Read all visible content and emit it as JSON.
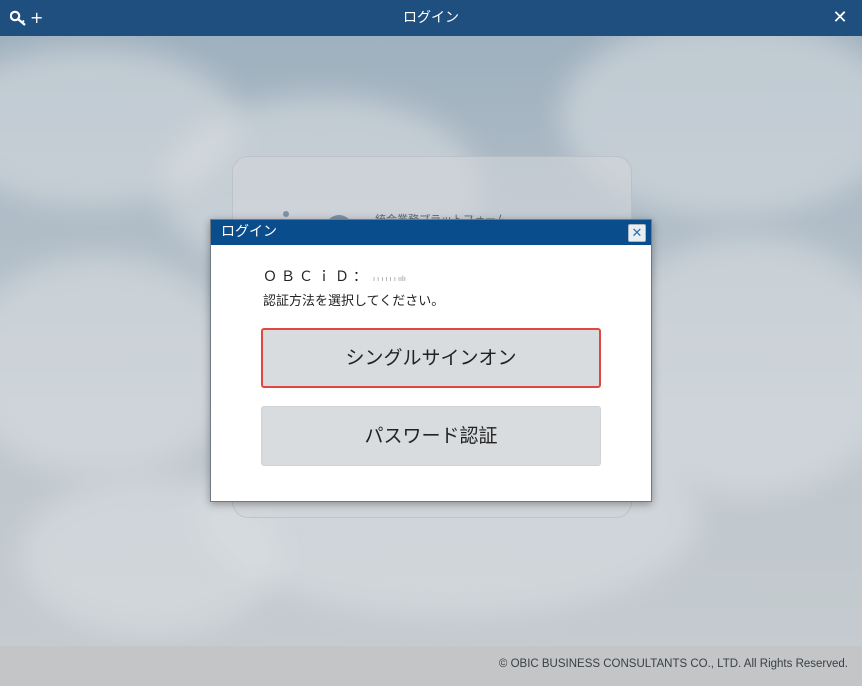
{
  "window": {
    "title": "ログイン",
    "key_add_plus": "+",
    "close_glyph": "✕"
  },
  "background": {
    "brand_text": "統合業務プラットフォーム"
  },
  "dialog": {
    "title": "ログイン",
    "close_glyph": "✕",
    "obcid_label": "ＯＢＣｉＤ：",
    "obcid_value": "ı ı ı ı ı ı ıılı",
    "prompt": "認証方法を選択してください。",
    "sso_button": "シングルサインオン",
    "password_button": "パスワード認証"
  },
  "footer": {
    "copyright": "© OBIC BUSINESS CONSULTANTS CO., LTD. All Rights Reserved."
  },
  "colors": {
    "titlebar": "#1e4f7e",
    "dialog_header": "#0a4d8c",
    "selected_border": "#e0473e",
    "button_bg": "#d9dcde"
  }
}
